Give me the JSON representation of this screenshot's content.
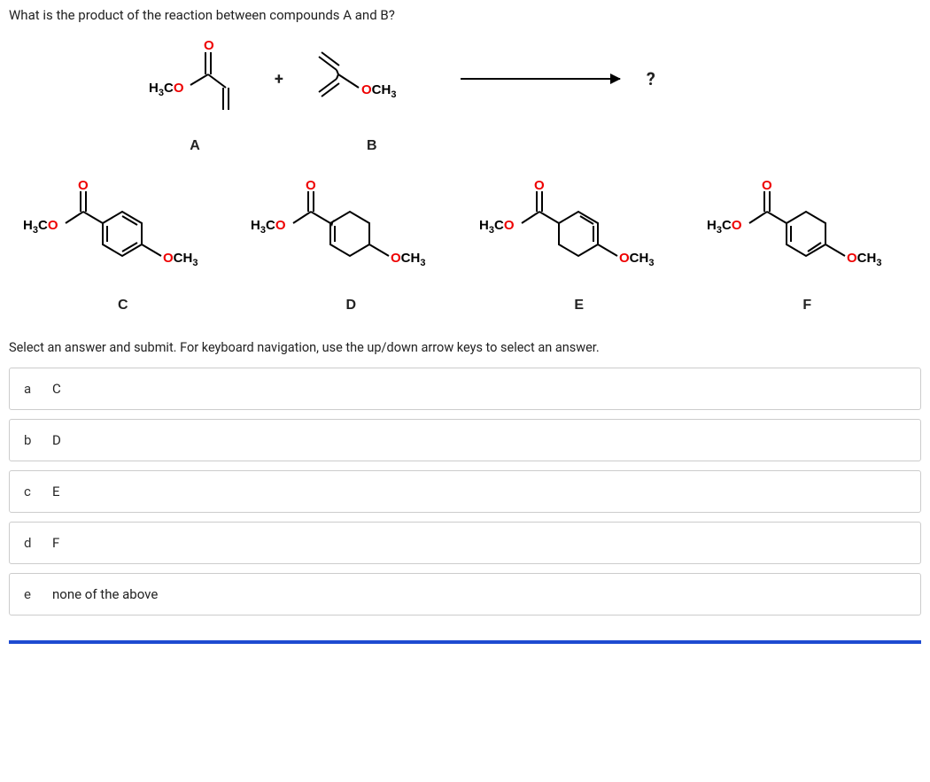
{
  "question": "What is the product of the reaction between compounds A and B?",
  "reaction": {
    "reactantA_label": "A",
    "reactantB_label": "B",
    "plus": "+",
    "product_placeholder": "?"
  },
  "option_labels": {
    "C": "C",
    "D": "D",
    "E": "E",
    "F": "F"
  },
  "instructions": "Select an answer and submit. For keyboard navigation, use the up/down arrow keys to select an answer.",
  "answers": [
    {
      "key": "a",
      "text": "C"
    },
    {
      "key": "b",
      "text": "D"
    },
    {
      "key": "c",
      "text": "E"
    },
    {
      "key": "d",
      "text": "F"
    },
    {
      "key": "e",
      "text": "none of the above"
    }
  ],
  "labels": {
    "H3CO_H": "H",
    "H3CO_3": "3",
    "H3CO_C": "C",
    "H3CO_O": "O",
    "OCH3_O": "O",
    "OCH3_C": "C",
    "OCH3_H": "H",
    "OCH3_3": "3",
    "O_top": "O"
  }
}
